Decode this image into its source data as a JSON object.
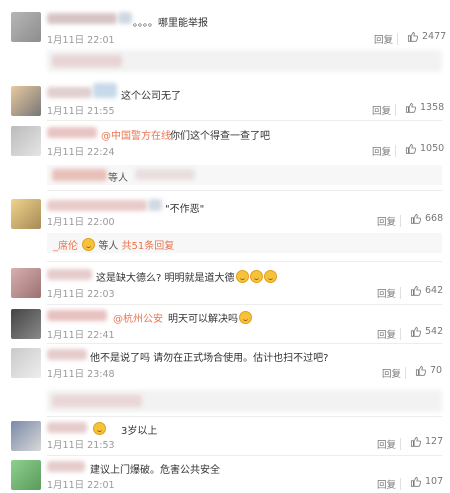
{
  "common": {
    "reply_label": "回复"
  },
  "comments": [
    {
      "text": "。。。。哪里能举报",
      "time": "1月11日 22:01",
      "likes": "2477"
    },
    {
      "text": "这个公司无了",
      "time": "1月11日 21:55",
      "likes": "1358"
    },
    {
      "mention": "@中国警方在线",
      "text": "你们这个得查一查了吧",
      "time": "1月11日 22:24",
      "likes": "1050",
      "sub_text": "等人"
    },
    {
      "text": "\"不作恶\"",
      "time": "1月11日 22:00",
      "likes": "668",
      "sub_name": "_席伦",
      "sub_mid": "等人",
      "sub_tail": "共51条回复"
    },
    {
      "text": "这是缺大德么? 明明就是道大德",
      "time": "1月11日 22:03",
      "likes": "642"
    },
    {
      "mention": "@杭州公安",
      "text": "明天可以解决吗",
      "time": "1月11日 22:41",
      "likes": "542"
    },
    {
      "text": "他不是说了吗 请勿在正式场合使用。估计也扫不过吧?",
      "time": "1月11日 23:48",
      "likes": "70"
    },
    {
      "text": "3岁以上",
      "time": "1月11日 21:53",
      "likes": "127"
    },
    {
      "text": "建议上门爆破。危害公共安全",
      "time": "1月11日 22:01",
      "likes": "107"
    }
  ]
}
